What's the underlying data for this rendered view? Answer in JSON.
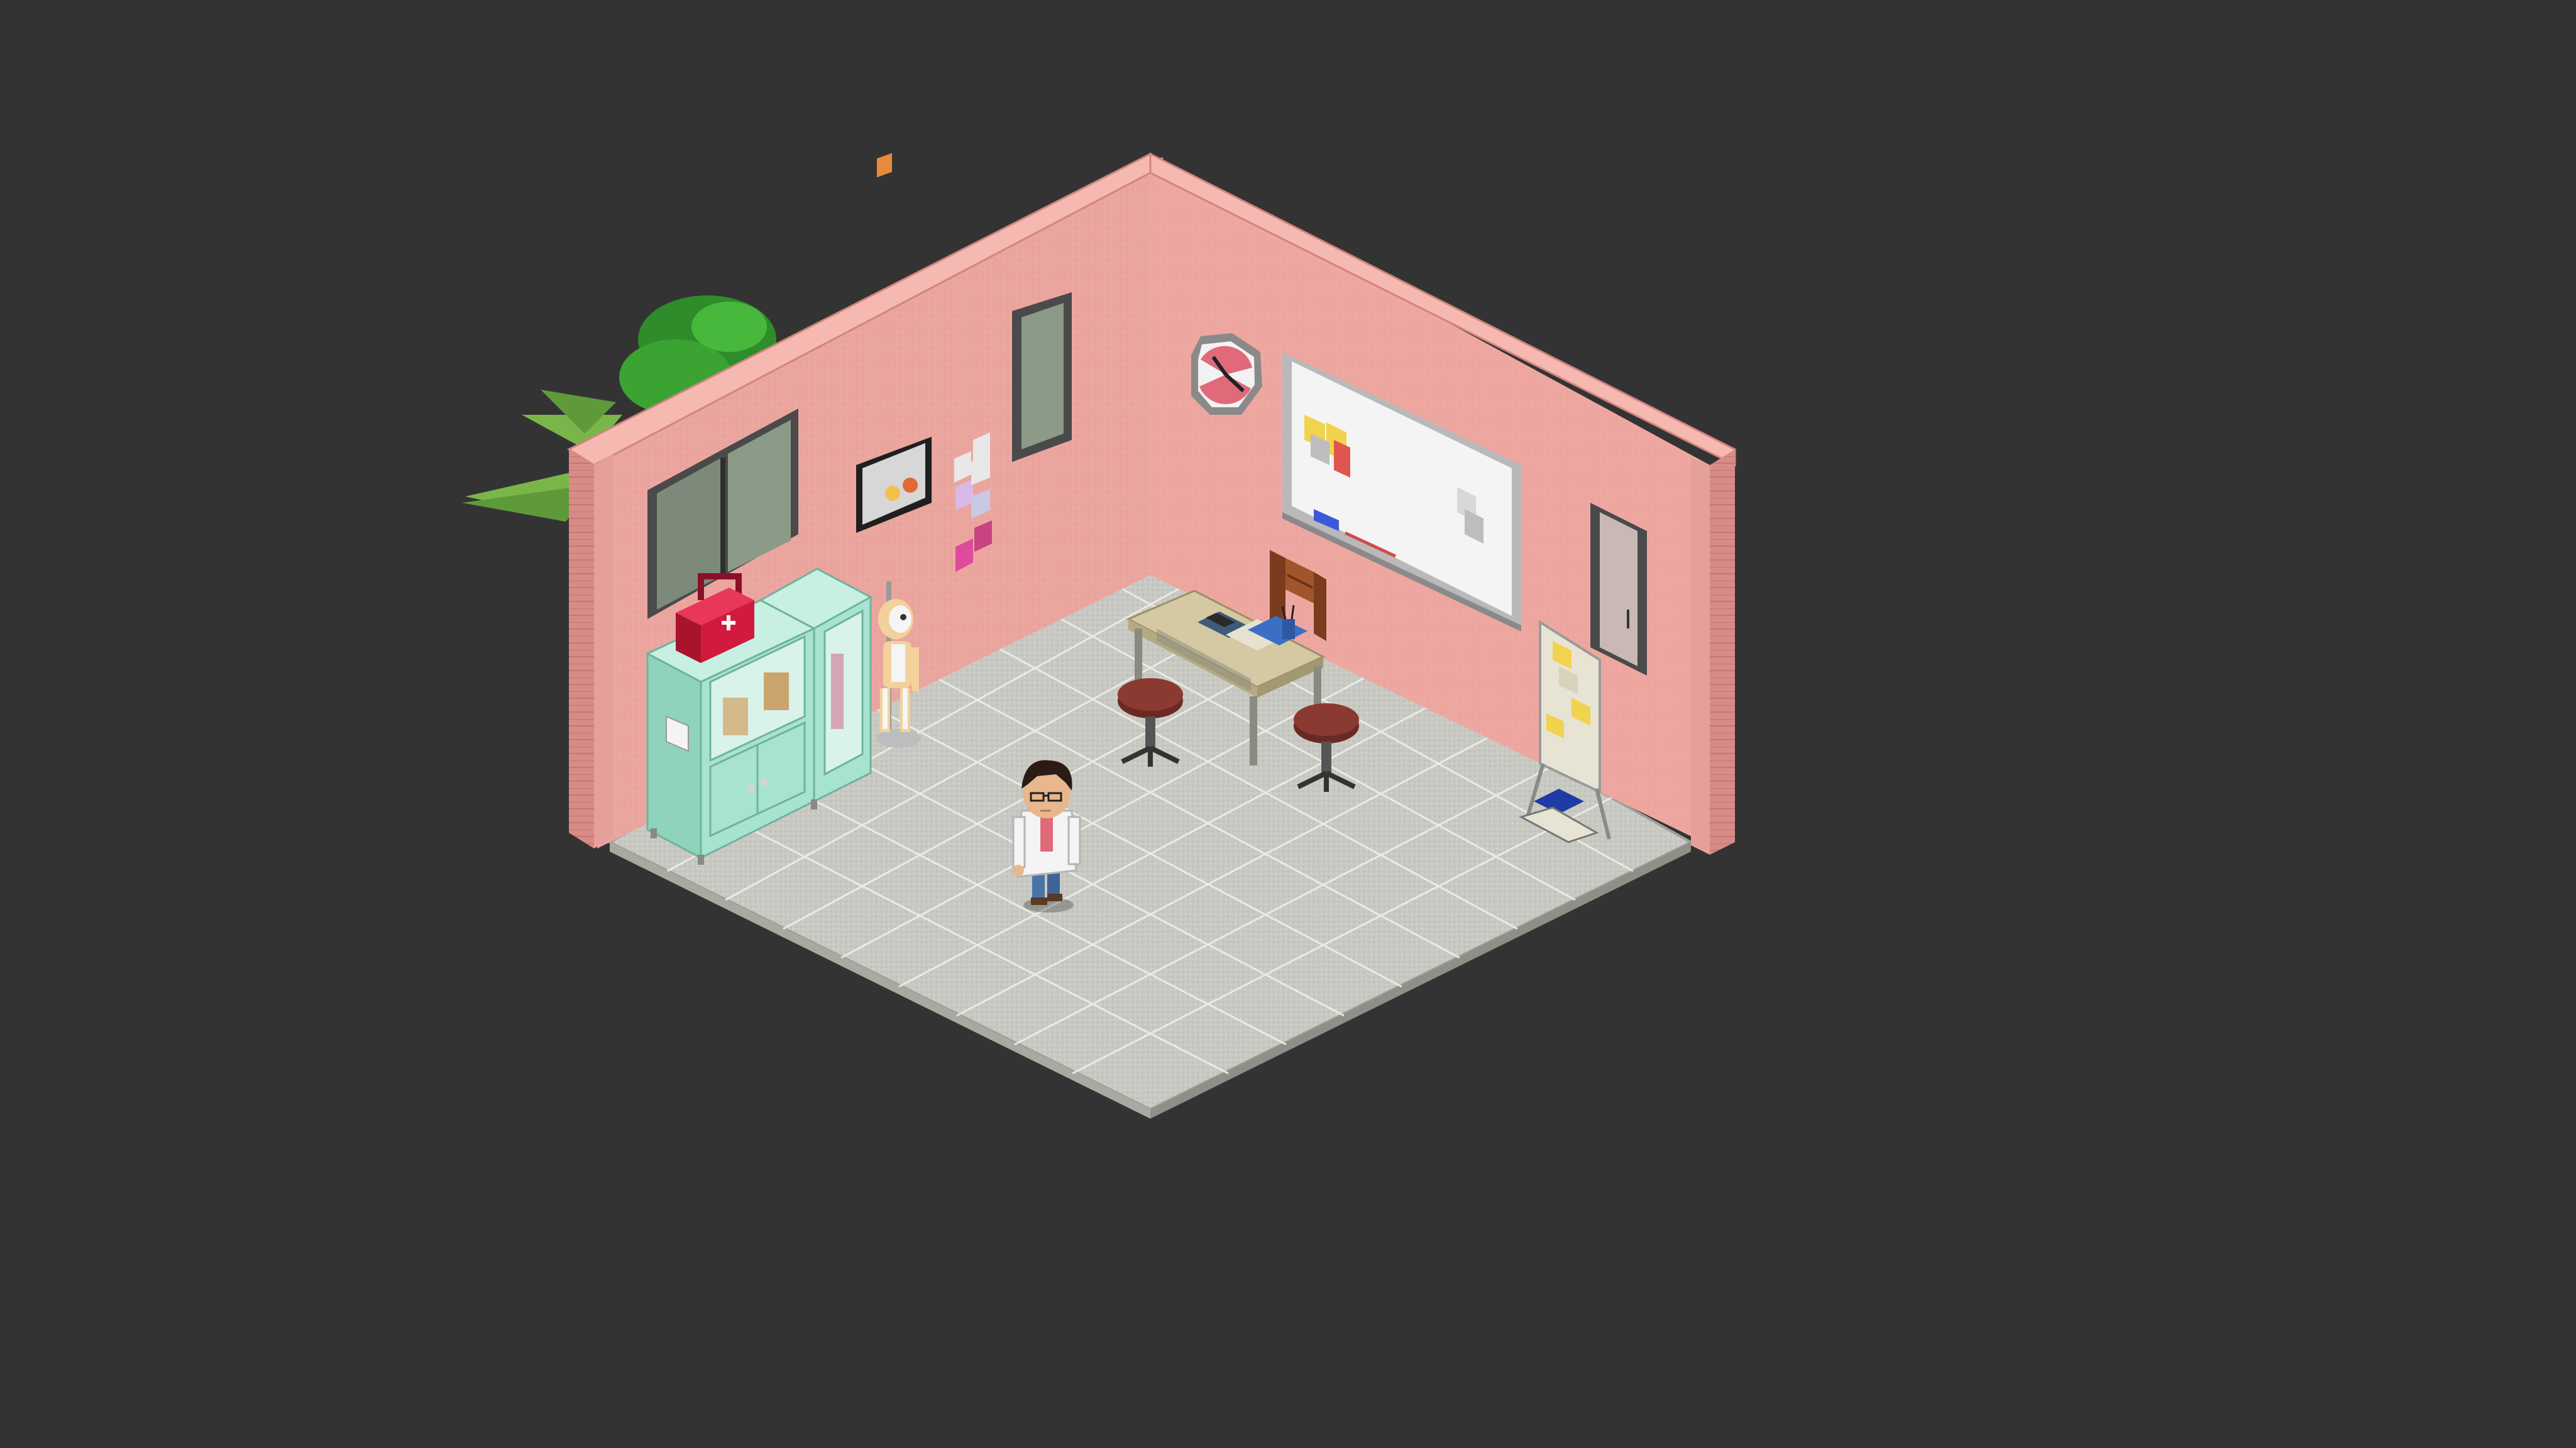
{
  "scene": {
    "type": "isometric-room",
    "room": "doctor's office",
    "colors": {
      "background": "#333333",
      "wall_left": "#e8a29c",
      "wall_right": "#f0aba4",
      "wall_top": "#f5b9b2",
      "brick_trim": "#d98b88",
      "floor_tile": "#c9c9c3",
      "floor_grout": "#eeeeea",
      "floor_edge": "#a9a9a2",
      "cabinet": "#a8e3cf",
      "medkit": "#d11a3e",
      "desk_wood": "#d4c9a2",
      "stool_seat": "#6a2a23",
      "whiteboard": "#f4f4f4",
      "plant": "#2f8c2a",
      "doctor_coat": "#f4f4f4"
    },
    "furniture": [
      {
        "name": "plant",
        "icon": "plant-icon"
      },
      {
        "name": "window",
        "icon": "window-icon"
      },
      {
        "name": "photo-frame",
        "icon": "frame-icon"
      },
      {
        "name": "sticky-notes",
        "icon": "note-icon"
      },
      {
        "name": "small-window",
        "icon": "window-icon"
      },
      {
        "name": "wall-clock",
        "icon": "clock-icon"
      },
      {
        "name": "whiteboard",
        "icon": "whiteboard-icon"
      },
      {
        "name": "wall-window-right",
        "icon": "window-icon"
      },
      {
        "name": "medicine-cabinet",
        "icon": "cabinet-icon"
      },
      {
        "name": "first-aid-kit",
        "icon": "first-aid-icon"
      },
      {
        "name": "skeleton-model",
        "icon": "skeleton-icon"
      },
      {
        "name": "desk",
        "icon": "desk-icon"
      },
      {
        "name": "desk-chair",
        "icon": "chair-icon"
      },
      {
        "name": "stool-left",
        "icon": "stool-icon"
      },
      {
        "name": "stool-right",
        "icon": "stool-icon"
      },
      {
        "name": "notice-stand",
        "icon": "board-icon"
      }
    ],
    "avatar": {
      "name": "doctor-avatar",
      "icon": "doctor-icon"
    }
  }
}
